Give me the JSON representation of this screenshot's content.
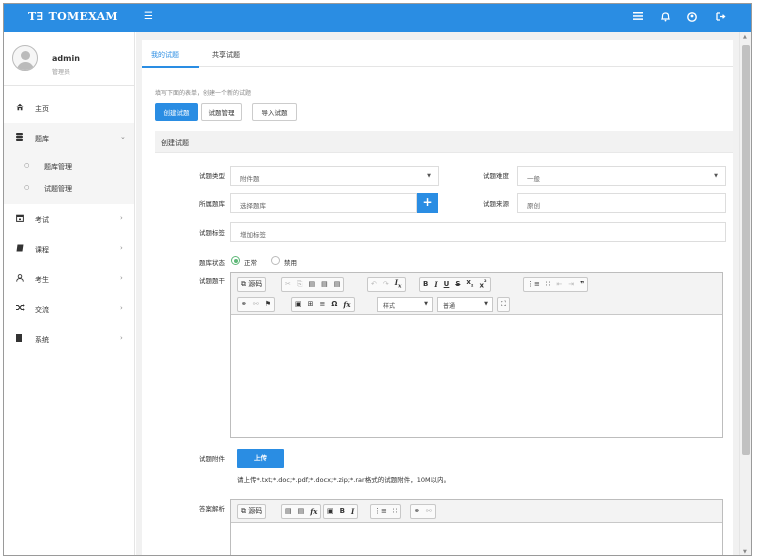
{
  "header": {
    "logo_mark": "T∃",
    "brand": "TOMEXAM",
    "menu_icon": "☰"
  },
  "topbar_icons": [
    "list-icon",
    "bell-icon",
    "user-circle-icon",
    "sign-out-icon"
  ],
  "user": {
    "name": "admin",
    "role": "管理员"
  },
  "sidebar": {
    "items": [
      {
        "label": "主页",
        "icon": "home-icon"
      },
      {
        "label": "题库",
        "icon": "database-icon",
        "arrow": "⌄"
      },
      {
        "label": "考试",
        "icon": "calendar-icon",
        "arrow": "›"
      },
      {
        "label": "课程",
        "icon": "book-icon",
        "arrow": "›"
      },
      {
        "label": "考生",
        "icon": "user-icon",
        "arrow": "›"
      },
      {
        "label": "交流",
        "icon": "shuffle-icon",
        "arrow": "›"
      },
      {
        "label": "系统",
        "icon": "server-icon",
        "arrow": "›"
      }
    ],
    "subitems": [
      {
        "label": "题库管理"
      },
      {
        "label": "试题管理"
      }
    ]
  },
  "tabs": [
    {
      "label": "我的试题"
    },
    {
      "label": "共享试题"
    }
  ],
  "hint": "填写下面的表单，创建一个新的试题",
  "actions": {
    "create": "创建试题",
    "manage": "试题管理",
    "import": "导入试题"
  },
  "section_title": "创建试题",
  "form": {
    "type_label": "试题类型",
    "type_value": "附件题",
    "difficulty_label": "试题难度",
    "difficulty_value": "一般",
    "bank_label": "所属题库",
    "bank_placeholder": "选择题库",
    "source_label": "试题来源",
    "source_placeholder": "原创",
    "tags_label": "试题标签",
    "tags_placeholder": "增加标签",
    "status_label": "题库状态",
    "status_on": "正常",
    "status_off": "禁用",
    "stem_label": "试题题干",
    "attach_label": "试题附件",
    "upload_button": "上传",
    "upload_hint": "请上传*.txt;*.doc;*.pdf;*.docx;*.zip;*.rar格式的试题附件，10M以内。",
    "analysis_label": "答案解析"
  },
  "editor": {
    "source_label": "源码",
    "style_label": "样式",
    "format_label": "普通"
  },
  "colors": {
    "primary": "#2a8de3",
    "radio_on": "#5fb878"
  }
}
